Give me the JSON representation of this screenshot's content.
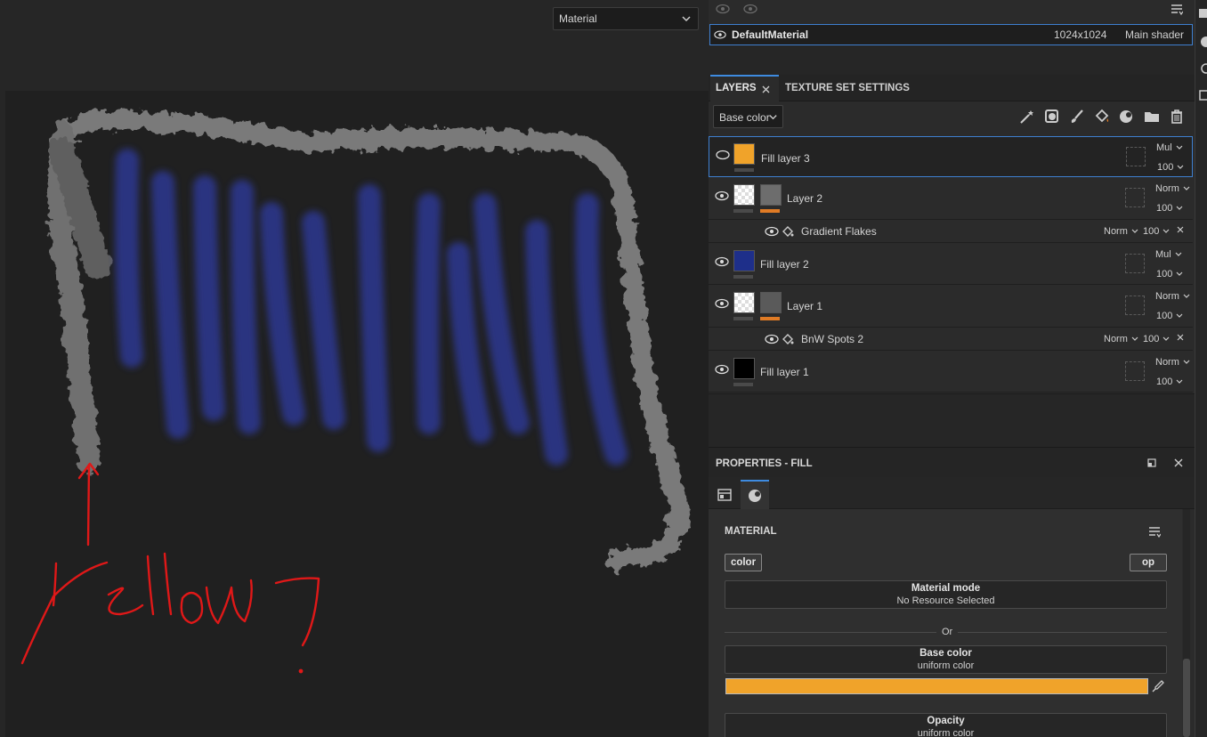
{
  "viewport": {
    "shading_mode": "Material",
    "annotation_text": "Yellow?"
  },
  "texture_set": {
    "name": "DefaultMaterial",
    "resolution": "1024x1024",
    "shader": "Main shader"
  },
  "tabs": [
    {
      "label": "LAYERS"
    },
    {
      "label": "TEXTURE SET SETTINGS"
    }
  ],
  "layers_toolbar": {
    "channel": "Base color",
    "icons": [
      "magic-wand-icon",
      "smart-mask-icon",
      "brush-icon",
      "fill-icon",
      "material-icon",
      "folder-icon",
      "trash-icon"
    ]
  },
  "layers": [
    {
      "name": "Fill layer 3",
      "blend": "Mul",
      "opacity": "100",
      "color": "#f0a32a",
      "selected": true
    },
    {
      "name": "Layer 2",
      "blend": "Norm",
      "opacity": "100",
      "effect": {
        "name": "Gradient Flakes",
        "blend": "Norm",
        "opacity": "100"
      }
    },
    {
      "name": "Fill layer 2",
      "blend": "Mul",
      "opacity": "100",
      "color": "#1e2f8a"
    },
    {
      "name": "Layer 1",
      "blend": "Norm",
      "opacity": "100",
      "effect": {
        "name": "BnW Spots 2",
        "blend": "Norm",
        "opacity": "100"
      }
    },
    {
      "name": "Fill layer 1",
      "blend": "Norm",
      "opacity": "100",
      "color": "#000000"
    }
  ],
  "properties": {
    "title": "PROPERTIES - FILL",
    "section": "MATERIAL",
    "chip_color": "color",
    "chip_op": "op",
    "material_mode_title": "Material mode",
    "material_mode_value": "No Resource Selected",
    "or_label": "Or",
    "base_color_title": "Base color",
    "base_color_value": "uniform color",
    "base_color_hex": "#f0a32a",
    "opacity_title": "Opacity",
    "opacity_value": "uniform color"
  },
  "colors": {
    "accent": "#3e8be0",
    "annotation": "#e01818",
    "strokes": "#2d3aa0"
  }
}
